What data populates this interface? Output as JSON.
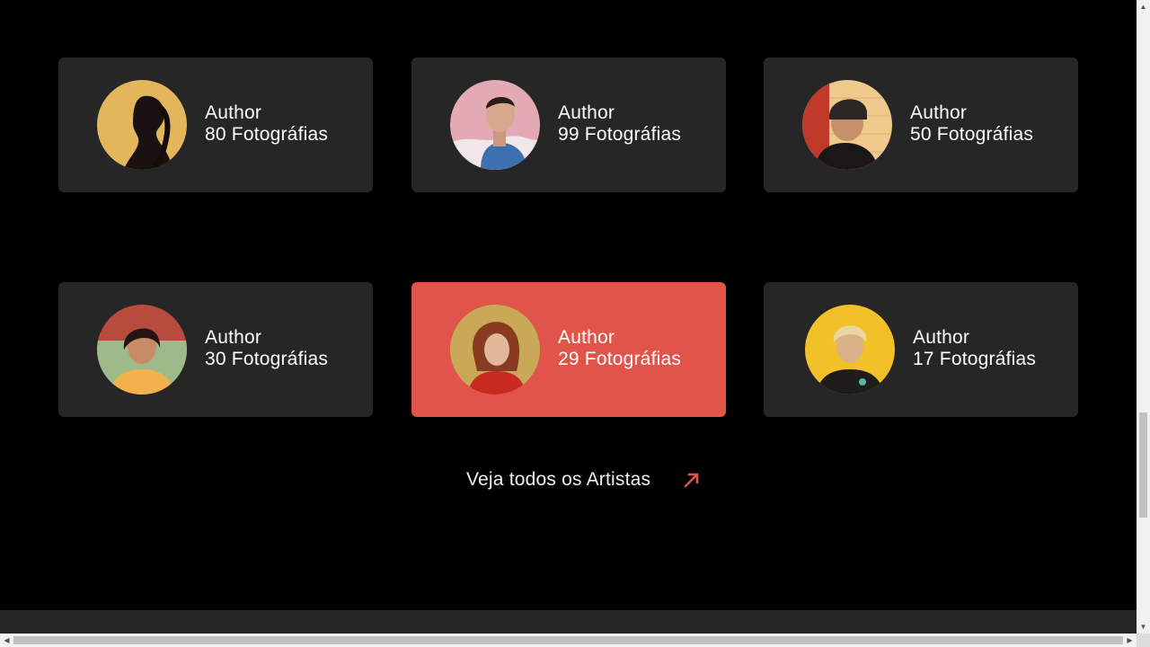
{
  "artists": [
    {
      "name": "Author",
      "photos": "80 Fotográfias"
    },
    {
      "name": "Author",
      "photos": "99 Fotográfias"
    },
    {
      "name": "Author",
      "photos": "50 Fotográfias"
    },
    {
      "name": "Author",
      "photos": "30 Fotográfias"
    },
    {
      "name": "Author",
      "photos": "29 Fotográfias"
    },
    {
      "name": "Author",
      "photos": "17 Fotográfias"
    }
  ],
  "see_all": {
    "label": "Veja todos os Artistas",
    "icon": "arrow-up-right-icon"
  },
  "colors": {
    "background": "#000000",
    "card": "#262626",
    "accent": "#e0544a"
  }
}
